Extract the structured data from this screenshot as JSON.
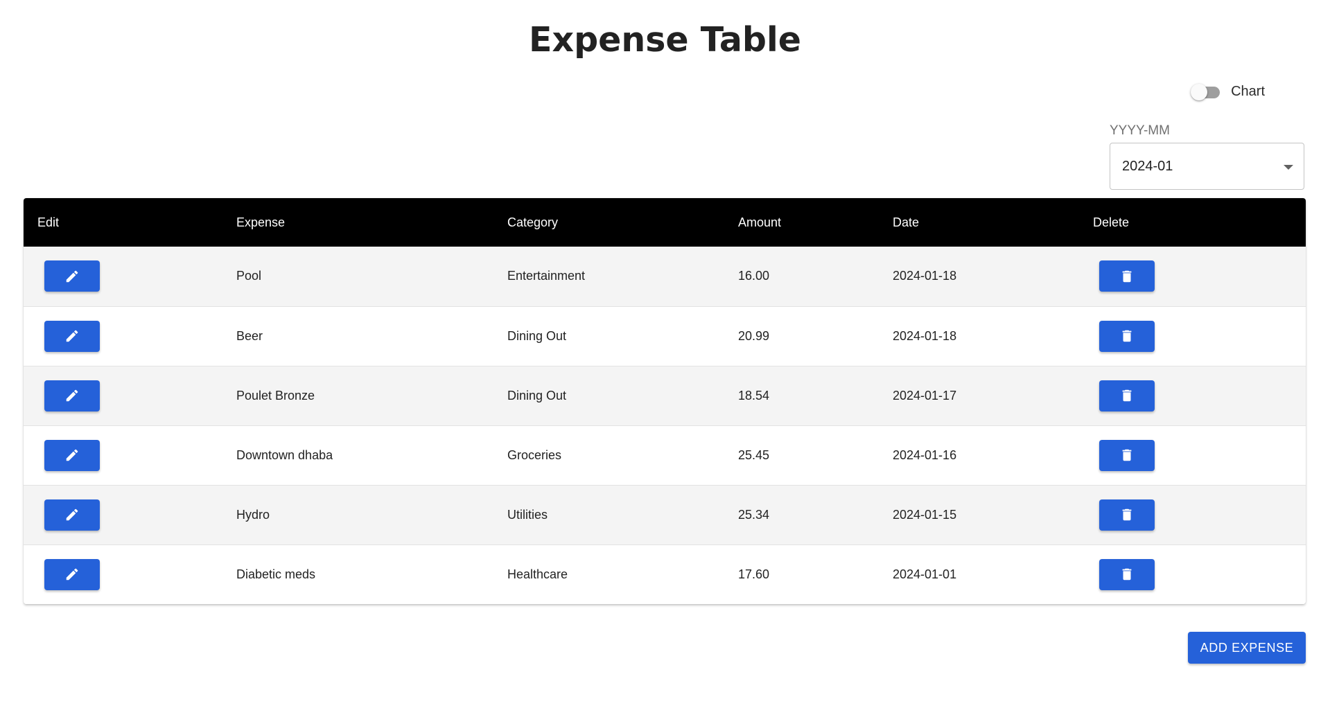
{
  "page": {
    "title": "Expense Table"
  },
  "chart_toggle": {
    "label": "Chart",
    "checked": false
  },
  "month_filter": {
    "label": "YYYY-MM",
    "value": "2024-01"
  },
  "table": {
    "columns": {
      "edit": "Edit",
      "expense": "Expense",
      "category": "Category",
      "amount": "Amount",
      "date": "Date",
      "delete": "Delete"
    },
    "rows": [
      {
        "expense": "Pool",
        "category": "Entertainment",
        "amount": "16.00",
        "date": "2024-01-18"
      },
      {
        "expense": "Beer",
        "category": "Dining Out",
        "amount": "20.99",
        "date": "2024-01-18"
      },
      {
        "expense": "Poulet Bronze",
        "category": "Dining Out",
        "amount": "18.54",
        "date": "2024-01-17"
      },
      {
        "expense": "Downtown dhaba",
        "category": "Groceries",
        "amount": "25.45",
        "date": "2024-01-16"
      },
      {
        "expense": "Hydro",
        "category": "Utilities",
        "amount": "25.34",
        "date": "2024-01-15"
      },
      {
        "expense": "Diabetic meds",
        "category": "Healthcare",
        "amount": "17.60",
        "date": "2024-01-01"
      }
    ],
    "edit_icon": "pencil-icon",
    "delete_icon": "trash-icon"
  },
  "actions": {
    "add_label": "ADD EXPENSE"
  },
  "colors": {
    "primary": "#2561d9",
    "header_bg": "#000000",
    "row_alt": "#f4f4f4"
  }
}
